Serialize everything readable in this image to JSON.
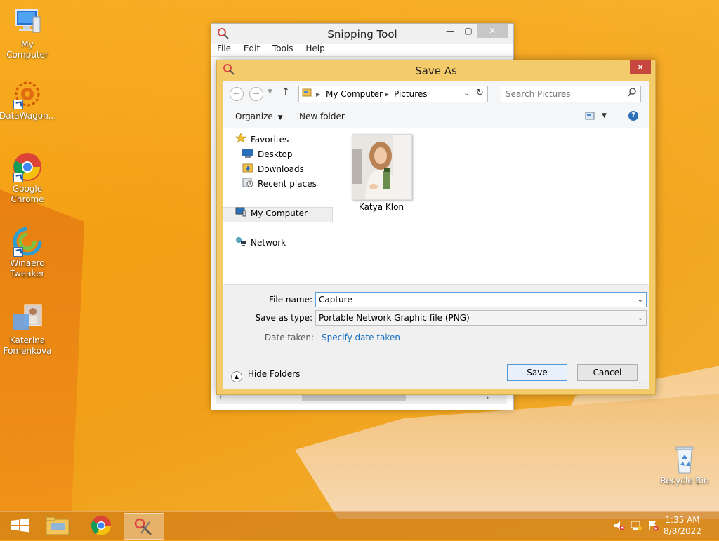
{
  "desktop": {
    "icons": [
      {
        "label": "My Computer"
      },
      {
        "label": "DataWagon..."
      },
      {
        "label": "Google Chrome"
      },
      {
        "label": "Winaero Tweaker"
      },
      {
        "label": "Katerina Fomenkova"
      },
      {
        "label": "Recycle Bin"
      }
    ]
  },
  "snipping_tool": {
    "title": "Snipping Tool",
    "menu": [
      "File",
      "Edit",
      "Tools",
      "Help"
    ]
  },
  "save_as": {
    "title": "Save As",
    "address": {
      "crumbs": [
        "My Computer",
        "Pictures"
      ]
    },
    "search": {
      "placeholder": "Search Pictures"
    },
    "commands": {
      "organize": "Organize",
      "new_folder": "New folder"
    },
    "nav": {
      "favorites": "Favorites",
      "desktop": "Desktop",
      "downloads": "Downloads",
      "recent": "Recent places",
      "my_computer": "My Computer",
      "network": "Network"
    },
    "files": [
      {
        "name": "Katya Klon"
      }
    ],
    "file_name": {
      "label": "File name:",
      "value": "Capture"
    },
    "save_type": {
      "label": "Save as type:",
      "value": "Portable Network Graphic file (PNG)"
    },
    "date_taken": {
      "label": "Date taken:",
      "link": "Specify date taken"
    },
    "hide_folders": "Hide Folders",
    "save": "Save",
    "cancel": "Cancel"
  },
  "taskbar": {
    "time": "1:35 AM",
    "date": "8/8/2022"
  },
  "colors": {
    "desktop": "#f4a015",
    "dialog_frame": "#f3cb6b",
    "close_red": "#c7463e",
    "link_blue": "#1a6fc2"
  }
}
